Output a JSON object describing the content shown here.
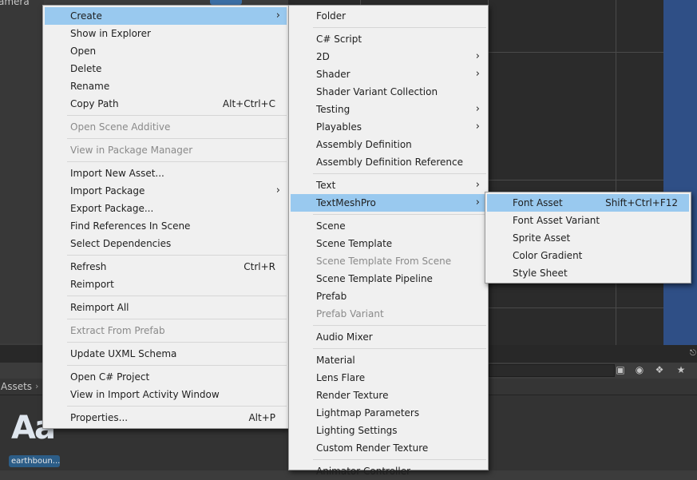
{
  "background": {
    "hierarchy_label": "amera",
    "breadcrumb": "Assets",
    "asset": {
      "preview_glyph": "Aa",
      "name": "earthboun..."
    }
  },
  "context_menu": [
    {
      "label": "Create",
      "submenu": true,
      "highlighted": true
    },
    {
      "label": "Show in Explorer"
    },
    {
      "label": "Open"
    },
    {
      "label": "Delete"
    },
    {
      "label": "Rename"
    },
    {
      "label": "Copy Path",
      "shortcut": "Alt+Ctrl+C"
    },
    {
      "separator": true
    },
    {
      "label": "Open Scene Additive",
      "disabled": true
    },
    {
      "separator": true
    },
    {
      "label": "View in Package Manager",
      "disabled": true
    },
    {
      "separator": true
    },
    {
      "label": "Import New Asset..."
    },
    {
      "label": "Import Package",
      "submenu": true
    },
    {
      "label": "Export Package..."
    },
    {
      "label": "Find References In Scene"
    },
    {
      "label": "Select Dependencies"
    },
    {
      "separator": true
    },
    {
      "label": "Refresh",
      "shortcut": "Ctrl+R"
    },
    {
      "label": "Reimport"
    },
    {
      "separator": true
    },
    {
      "label": "Reimport All"
    },
    {
      "separator": true
    },
    {
      "label": "Extract From Prefab",
      "disabled": true
    },
    {
      "separator": true
    },
    {
      "label": "Update UXML Schema"
    },
    {
      "separator": true
    },
    {
      "label": "Open C# Project"
    },
    {
      "label": "View in Import Activity Window"
    },
    {
      "separator": true
    },
    {
      "label": "Properties...",
      "shortcut": "Alt+P"
    }
  ],
  "create_menu": [
    {
      "label": "Folder"
    },
    {
      "separator": true
    },
    {
      "label": "C# Script"
    },
    {
      "label": "2D",
      "submenu": true
    },
    {
      "label": "Shader",
      "submenu": true
    },
    {
      "label": "Shader Variant Collection"
    },
    {
      "label": "Testing",
      "submenu": true
    },
    {
      "label": "Playables",
      "submenu": true
    },
    {
      "label": "Assembly Definition"
    },
    {
      "label": "Assembly Definition Reference"
    },
    {
      "separator": true
    },
    {
      "label": "Text",
      "submenu": true
    },
    {
      "label": "TextMeshPro",
      "submenu": true,
      "highlighted": true
    },
    {
      "separator": true
    },
    {
      "label": "Scene"
    },
    {
      "label": "Scene Template"
    },
    {
      "label": "Scene Template From Scene",
      "disabled": true
    },
    {
      "label": "Scene Template Pipeline"
    },
    {
      "label": "Prefab"
    },
    {
      "label": "Prefab Variant",
      "disabled": true
    },
    {
      "separator": true
    },
    {
      "label": "Audio Mixer"
    },
    {
      "separator": true
    },
    {
      "label": "Material"
    },
    {
      "label": "Lens Flare"
    },
    {
      "label": "Render Texture"
    },
    {
      "label": "Lightmap Parameters"
    },
    {
      "label": "Lighting Settings"
    },
    {
      "label": "Custom Render Texture"
    },
    {
      "separator": true
    },
    {
      "label": "Animator Controller"
    }
  ],
  "textmeshpro_menu": [
    {
      "label": "Font Asset",
      "shortcut": "Shift+Ctrl+F12",
      "highlighted": true
    },
    {
      "label": "Font Asset Variant"
    },
    {
      "label": "Sprite Asset"
    },
    {
      "label": "Color Gradient"
    },
    {
      "label": "Style Sheet"
    }
  ],
  "colors": {
    "menu_bg": "#f0f0f0",
    "highlight": "#99c9ef",
    "disabled_text": "#8a8a8a",
    "editor_bg": "#3c3c3c",
    "scene_blue": "#2f4f86"
  },
  "icons": {
    "submenu": "chevron-right-icon",
    "toolbar": [
      "search-by-type-icon",
      "filter-by-label-icon",
      "favorite-star-icon"
    ]
  }
}
